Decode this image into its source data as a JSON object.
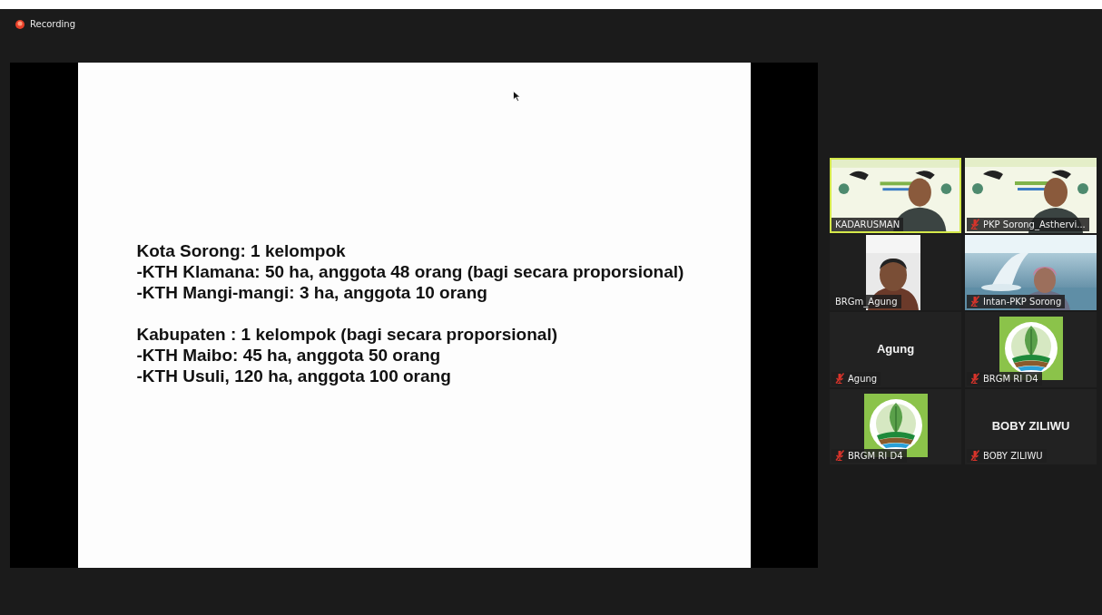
{
  "recording": {
    "label": "Recording"
  },
  "slide": {
    "blocks": [
      {
        "lines": [
          "Kota Sorong: 1 kelompok",
          "-KTH Klamana: 50 ha, anggota 48 orang (bagi secara proporsional)",
          "-KTH Mangi-mangi: 3 ha, anggota 10 orang"
        ]
      },
      {
        "lines": [
          "Kabupaten : 1 kelompok (bagi secara proporsional)",
          "-KTH Maibo: 45 ha, anggota 50 orang",
          "-KTH Usuli, 120 ha, anggota 100 orang"
        ]
      }
    ]
  },
  "participants": [
    {
      "kind": "video",
      "name": "KADARUSMAN",
      "muted": false,
      "speaking": true
    },
    {
      "kind": "video",
      "name": "PKP Sorong_Asthervi...",
      "muted": true,
      "speaking": false
    },
    {
      "kind": "video",
      "name": "BRGm_Agung",
      "muted": false,
      "speaking": false
    },
    {
      "kind": "video",
      "name": "Intan-PKP Sorong",
      "muted": true,
      "speaking": false
    },
    {
      "kind": "name",
      "display_name": "Agung",
      "name": "Agung",
      "muted": true,
      "speaking": false
    },
    {
      "kind": "logo",
      "name": "BRGM RI D4",
      "muted": true,
      "speaking": false
    },
    {
      "kind": "logo",
      "name": "BRGM RI D4",
      "muted": true,
      "speaking": false
    },
    {
      "kind": "name",
      "display_name": "BOBY ZILIWU",
      "name": "BOBY ZILIWU",
      "muted": true,
      "speaking": false
    }
  ]
}
